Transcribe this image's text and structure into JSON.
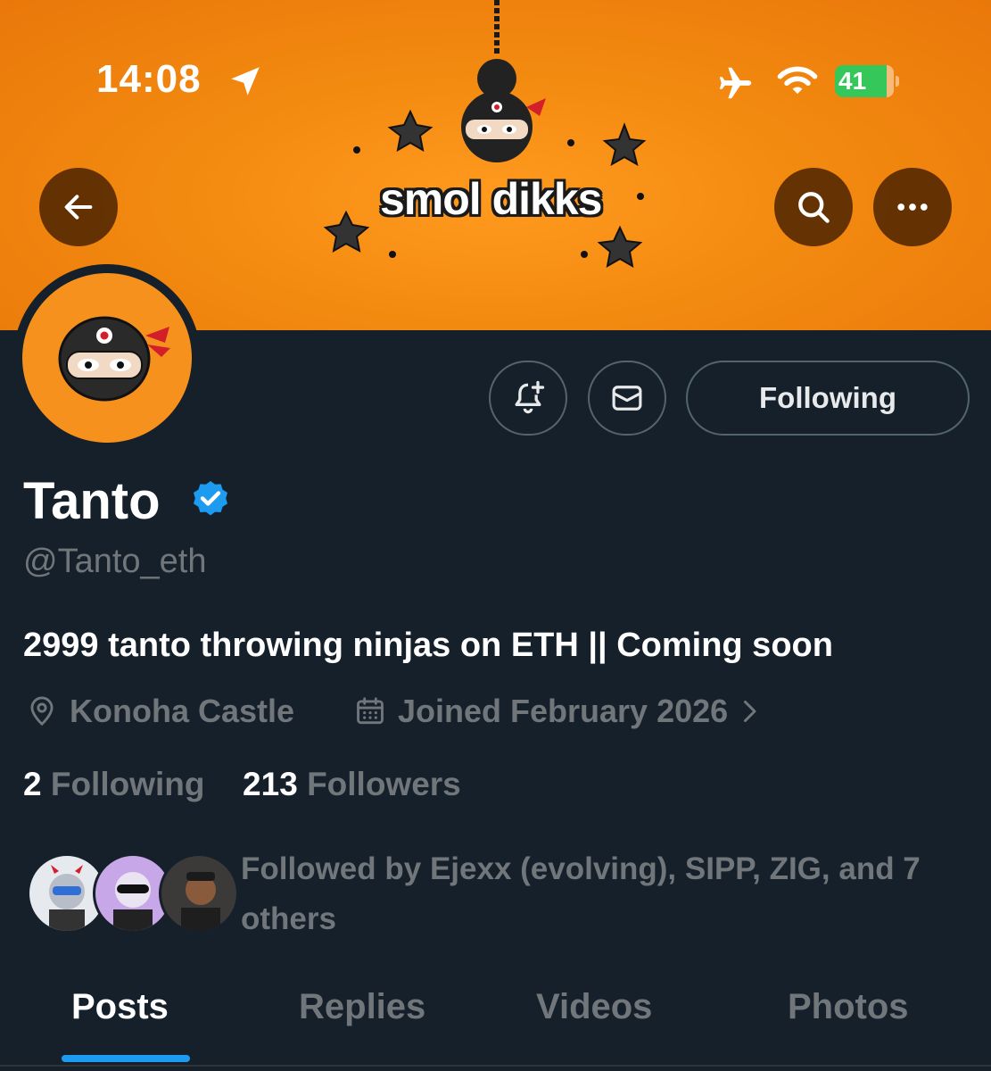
{
  "status_bar": {
    "time": "14:08",
    "battery_percent": "41",
    "icons": [
      "location-arrow-icon",
      "airplane-icon",
      "wifi-icon",
      "battery-charging-icon"
    ]
  },
  "banner": {
    "logo_text": "smol dikks",
    "color": "#f38a10"
  },
  "nav": {
    "icons": [
      "back-arrow-icon",
      "search-icon",
      "more-icon"
    ]
  },
  "profile": {
    "name": "Tanto",
    "handle": "@Tanto_eth",
    "bio": "2999 tanto throwing ninjas on ETH || Coming soon",
    "location": "Konoha Castle",
    "joined": "Joined February 2026",
    "following_count": "2",
    "following_label": "Following",
    "followers_count": "213",
    "followers_label": "Followers",
    "followed_by": "Followed by Ejexx (evolving), SIPP, ZIG, and 7 others",
    "verified_color": "#1d9bf0"
  },
  "actions": {
    "following_button": "Following"
  },
  "tabs": [
    {
      "label": "Posts",
      "active": true
    },
    {
      "label": "Replies",
      "active": false
    },
    {
      "label": "Videos",
      "active": false
    },
    {
      "label": "Photos",
      "active": false
    }
  ],
  "colors": {
    "background": "#15202b",
    "muted_text": "#71767b",
    "accent": "#1d9bf0"
  }
}
